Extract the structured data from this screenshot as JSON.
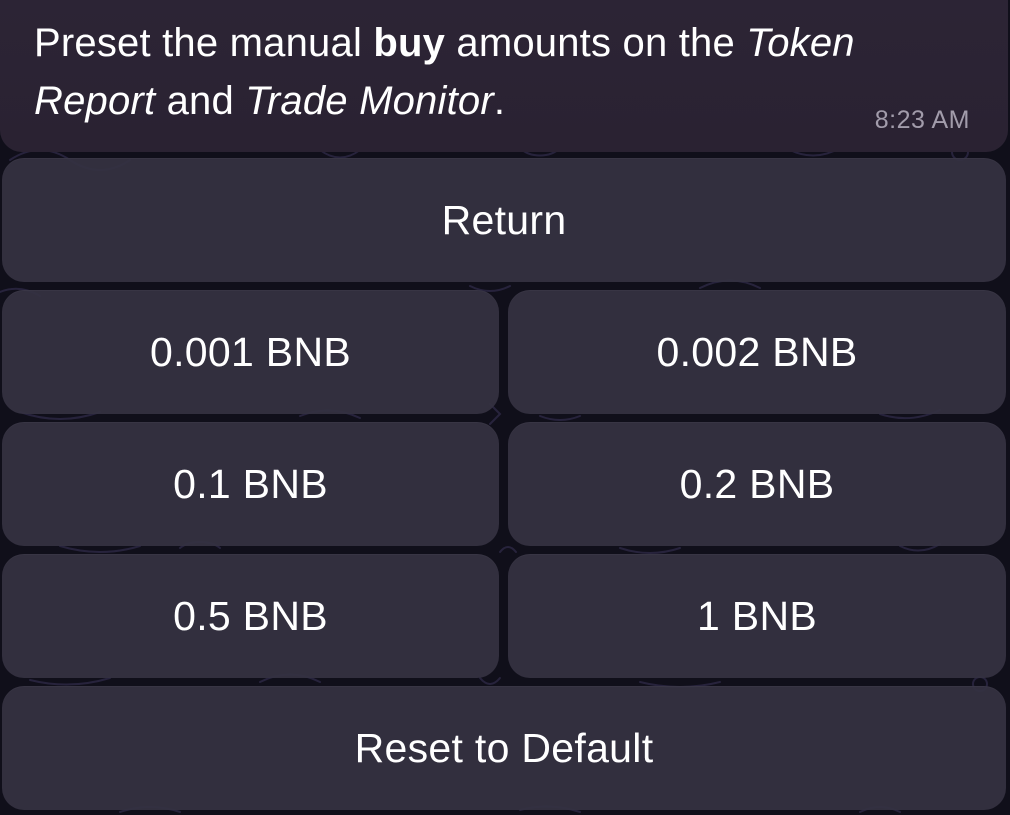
{
  "message": {
    "segments": [
      {
        "text": "Preset the manual ",
        "style": "normal"
      },
      {
        "text": "buy",
        "style": "bold"
      },
      {
        "text": " amounts on the ",
        "style": "normal"
      },
      {
        "text": "Token Report",
        "style": "italic"
      },
      {
        "text": " and ",
        "style": "normal"
      },
      {
        "text": "Trade Monitor",
        "style": "italic"
      },
      {
        "text": ".",
        "style": "normal"
      }
    ],
    "time": "8:23 AM"
  },
  "keyboard": {
    "return_label": "Return",
    "amounts": [
      {
        "label": "0.001 BNB"
      },
      {
        "label": "0.002 BNB"
      },
      {
        "label": "0.1 BNB"
      },
      {
        "label": "0.2 BNB"
      },
      {
        "label": "0.5 BNB"
      },
      {
        "label": "1 BNB"
      }
    ],
    "reset_label": "Reset to Default"
  },
  "colors": {
    "background": "#100f1a",
    "bubble": "#2c2435",
    "button": "#353242",
    "text": "#ffffff",
    "timestamp": "#a29cab"
  }
}
